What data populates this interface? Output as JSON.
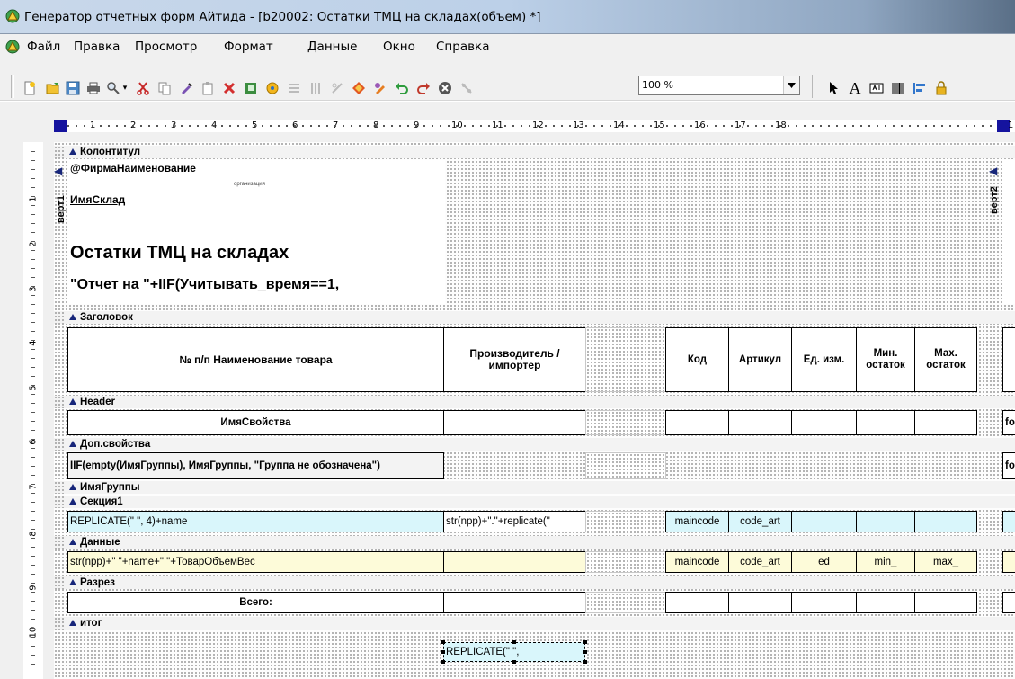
{
  "window": {
    "title": "Генератор отчетных форм Айтида - [b20002: Остатки ТМЦ на складах(объем) *]"
  },
  "menu": {
    "items": [
      "Файл",
      "Правка",
      "Просмотр",
      "Формат",
      "Данные",
      "Окно",
      "Справка"
    ]
  },
  "toolbar": {
    "zoom_value": "100 %",
    "text_tool_label": "A"
  },
  "ruler": {
    "top_numbers": [
      "1",
      "2",
      "3",
      "4",
      "5",
      "6",
      "7",
      "8",
      "9",
      "10",
      "11",
      "12",
      "13",
      "14",
      "15",
      "16",
      "17",
      "18",
      "1"
    ],
    "left_numbers": [
      "1",
      "2",
      "3",
      "4",
      "5",
      "6",
      "7",
      "8",
      "9",
      "10"
    ]
  },
  "report": {
    "bands": {
      "kolontitul": "Колонтитул",
      "zagolovok": "Заголовок",
      "header": "Header",
      "dop_svoistva": "Доп.свойства",
      "imya_gruppy": "ИмяГруппы",
      "sekciya1": "Секция1",
      "dannye": "Данные",
      "razrez": "Разрез",
      "itog": "итог"
    },
    "page_header": {
      "firm_name": "@ФирмаНаименование",
      "firm_caption": "организация",
      "warehouse": "ИмяСклад",
      "vert1": "верт1",
      "vert2": "верт2",
      "title": "Остатки ТМЦ на складах",
      "subtitle": "\"Отчет на \"+IIF(Учитывать_время==1,"
    },
    "columns": {
      "name": "№ п/п Наименование товара",
      "producer": "Производитель / импортер",
      "code": "Код",
      "article": "Артикул",
      "unit": "Ед. изм.",
      "min": "Мин. остаток",
      "max": "Мах. остаток"
    },
    "header_row": {
      "property_name": "ИмяСвойства",
      "right_fragment": "fo"
    },
    "dop_row": {
      "expression": "IIF(empty(ИмяГруппы),  ИмяГруппы, \"Группа не обозначена\")",
      "right_fragment": "fo"
    },
    "section1_row": {
      "name": "REPLICATE(\" \", 4)+name",
      "producer": "str(npp)+\".\"+replicate(\"",
      "code": "maincode",
      "article": "code_art"
    },
    "data_row": {
      "name": "str(npp)+\"   \"+name+\" \"+ТоварОбъемВес",
      "code": "maincode",
      "article": "code_art",
      "unit": "ed",
      "min": "min_",
      "max": "max_"
    },
    "razrez_row": {
      "total": "Всего:"
    },
    "itog_row": {
      "selected_cell": "REPLICATE(\" \","
    }
  }
}
